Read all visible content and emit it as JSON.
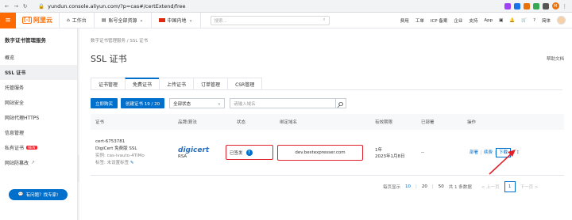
{
  "browser": {
    "url": "yundun.console.aliyun.com/?p=cas#/certExtend/free",
    "profile_initial": "M"
  },
  "topbar": {
    "logo_text": "阿里云",
    "workbench": "工作台",
    "account_scope": "账号全部资源",
    "region": "中国内地",
    "search_placeholder": "搜索...",
    "links": [
      "费用",
      "工单",
      "ICP 备案",
      "企业",
      "支持",
      "App"
    ],
    "lang": "简体"
  },
  "sidebar": {
    "title": "数字证书管理服务",
    "items": [
      {
        "label": "概览"
      },
      {
        "label": "SSL 证书"
      },
      {
        "label": "托管服务"
      },
      {
        "label": "网站安全"
      },
      {
        "label": "网站代理HTTPS"
      },
      {
        "label": "信息管理"
      },
      {
        "label": "私有证书"
      },
      {
        "label": "网站防篡改"
      }
    ],
    "new_badge": "NEW",
    "help_button": "有问题？找专家!"
  },
  "main": {
    "breadcrumb": "数字证书管理服务 / SSL 证书",
    "title": "SSL 证书",
    "doc_link": "帮助文档",
    "tabs": [
      {
        "label": "证书管理"
      },
      {
        "label": "免费证书"
      },
      {
        "label": "上传证书"
      },
      {
        "label": "订单管理"
      },
      {
        "label": "CSR管理"
      }
    ],
    "toolbar": {
      "buy_now": "立即购买",
      "create_cert": "创建证书 19 / 20",
      "status_select": "全部状态",
      "search_placeholder": "请输入域名"
    },
    "table": {
      "headers": [
        "证书",
        "品牌/算法",
        "状态",
        "绑定域名",
        "有效期限",
        "已部署",
        "操作"
      ],
      "row": {
        "cert_name": "cert-6753781",
        "cert_type": "DigiCert 免费版 SSL",
        "instance": "实例: cas-ivauto-4TIMo",
        "tag": "标签: 未设置标签",
        "brand": "digicert",
        "algorithm": "RSA",
        "status": "已签发",
        "domain": "dev.bestexpresser.com",
        "validity_1": "1年",
        "validity_2": "2023年1月8日",
        "deployed": "--",
        "actions": [
          "部署",
          "续费",
          "下载"
        ]
      }
    },
    "pagination": {
      "page_size_label": "每页显示",
      "sizes": [
        "10",
        "20",
        "50"
      ],
      "total": "共 1 条数据",
      "prev": "< 上一页",
      "current": "1",
      "next": "下一页 >"
    }
  }
}
